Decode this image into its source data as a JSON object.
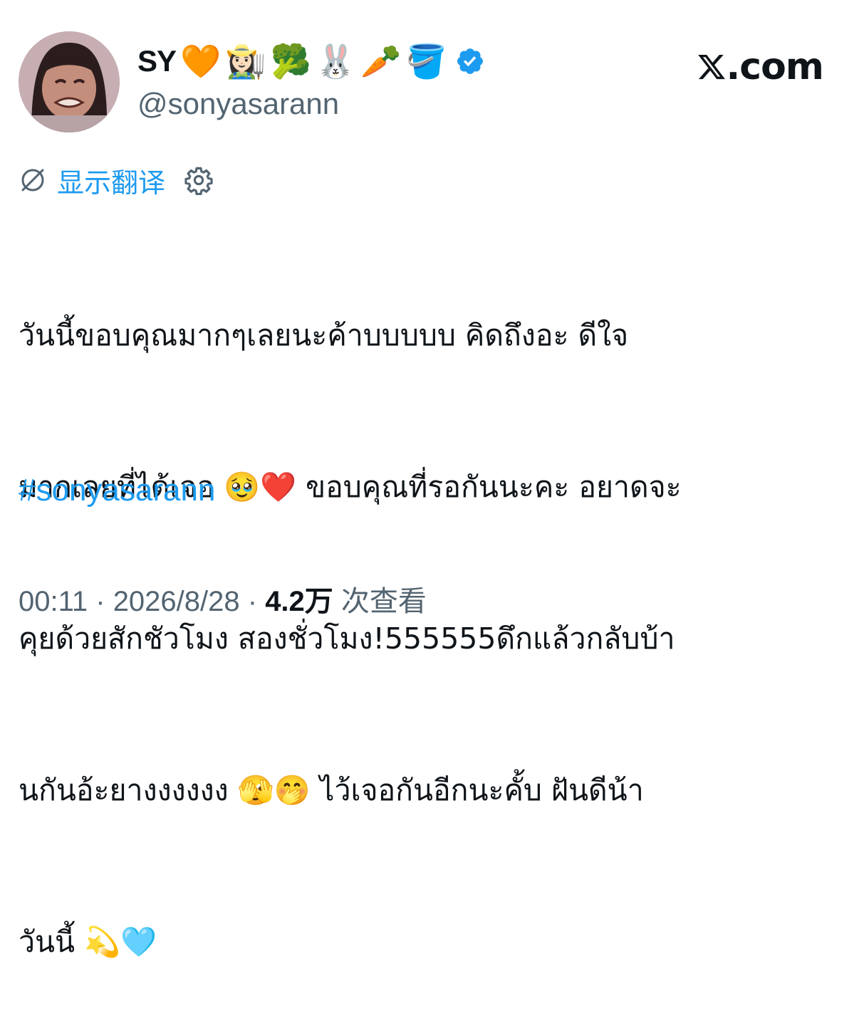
{
  "author": {
    "display_name": "SY",
    "name_emojis": [
      "🧡",
      "👩🏻‍🌾",
      "🥦",
      "🐰",
      "🥕",
      "🪣"
    ],
    "handle": "@sonyasarann",
    "verified_color": "#1d9bf0"
  },
  "brand": {
    "logo_suffix": ".com"
  },
  "translate": {
    "label": "显示翻译"
  },
  "tweet": {
    "lines": [
      "วันนี้ขอบคุณมากๆเลยนะค้าบบบบบ คิดถึงอะ ดีใจ",
      "มากเลยที่ได้เจอ 🥹❤️ ขอบคุณที่รอกันนะคะ อยาดจะ",
      "คุยด้วยสักชัวโมง สองชั่วโมง!555555ดึกแล้วกลับบ้า",
      "นกันอ้ะยางงงงงง 🫣🤭 ไว้เจอกันอีกนะคั้บ ฝันดีน้า",
      "วันนี้ 💫🩵"
    ],
    "hashtag": "#sonyasarann"
  },
  "meta": {
    "time": "00:11",
    "sep1": " · ",
    "date": "2026/8/28",
    "sep2": " · ",
    "views": "4.2万",
    "views_label": " 次查看"
  },
  "colors": {
    "accent": "#1d9bf0",
    "secondary_text": "#536471",
    "primary_text": "#0f1419"
  }
}
